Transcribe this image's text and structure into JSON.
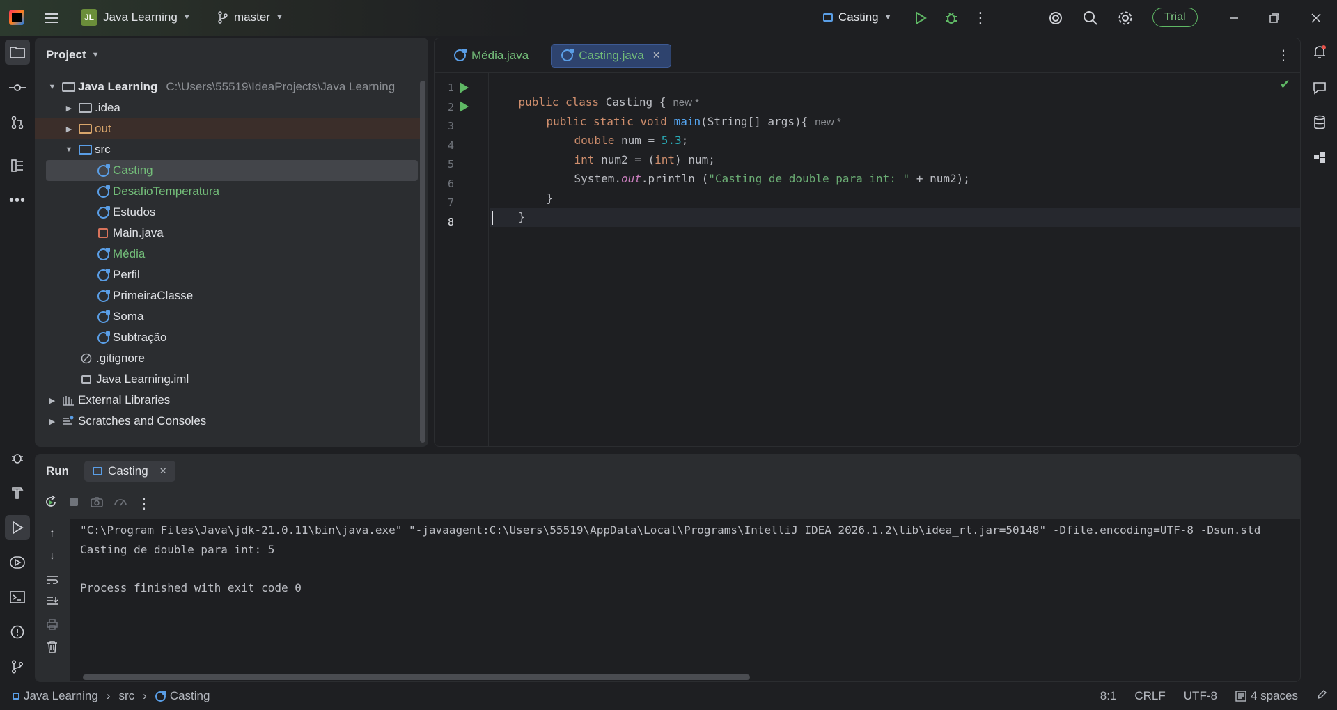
{
  "titlebar": {
    "project_badge": "JL",
    "project_name": "Java Learning",
    "branch": "master",
    "run_config": "Casting",
    "trial_label": "Trial"
  },
  "project_panel": {
    "title": "Project",
    "root": {
      "name": "Java Learning",
      "path": "C:\\Users\\55519\\IdeaProjects\\Java Learning"
    },
    "items": [
      {
        "label": ".idea"
      },
      {
        "label": "out"
      },
      {
        "label": "src"
      },
      {
        "label": "Casting"
      },
      {
        "label": "DesafioTemperatura"
      },
      {
        "label": "Estudos"
      },
      {
        "label": "Main.java"
      },
      {
        "label": "Média"
      },
      {
        "label": "Perfil"
      },
      {
        "label": "PrimeiraClasse"
      },
      {
        "label": "Soma"
      },
      {
        "label": "Subtração"
      },
      {
        "label": ".gitignore"
      },
      {
        "label": "Java Learning.iml"
      },
      {
        "label": "External Libraries"
      },
      {
        "label": "Scratches and Consoles"
      }
    ]
  },
  "editor": {
    "tabs": [
      {
        "label": "Média.java"
      },
      {
        "label": "Casting.java"
      }
    ],
    "line_numbers": [
      "1",
      "2",
      "3",
      "4",
      "5",
      "6",
      "7",
      "8"
    ],
    "hint_new": "new *",
    "code": {
      "l1_kw": "public class",
      "l1_name": " Casting {",
      "l2_kw": "public static void",
      "l2_fn": "main",
      "l2_rest": "(String[] args){",
      "l3_kw": "double",
      "l3_rest": " num = ",
      "l3_num": "5.3",
      "l3_end": ";",
      "l4_kw": "int",
      "l4_a": " num2 = (",
      "l4_kw2": "int",
      "l4_b": ") num;",
      "l5_a": "System.",
      "l5_fld": "out",
      "l5_b": ".println (",
      "l5_str": "\"Casting de double para int: \"",
      "l5_c": " + num2);",
      "l6": "}",
      "l7": "}"
    }
  },
  "run_panel": {
    "title": "Run",
    "tab": "Casting",
    "console": [
      "\"C:\\Program Files\\Java\\jdk-21.0.11\\bin\\java.exe\" \"-javaagent:C:\\Users\\55519\\AppData\\Local\\Programs\\IntelliJ IDEA 2026.1.2\\lib\\idea_rt.jar=50148\" -Dfile.encoding=UTF-8 -Dsun.std",
      "Casting de double para int: 5",
      "",
      "Process finished with exit code 0"
    ]
  },
  "statusbar": {
    "crumbs": [
      "Java Learning",
      "src",
      "Casting"
    ],
    "position": "8:1",
    "line_ending": "CRLF",
    "encoding": "UTF-8",
    "indent": "4 spaces"
  },
  "colors": {
    "accent_green": "#5fb865",
    "class_blue": "#5a9ee6",
    "keyword": "#cf8e6d",
    "string": "#6aab73"
  }
}
